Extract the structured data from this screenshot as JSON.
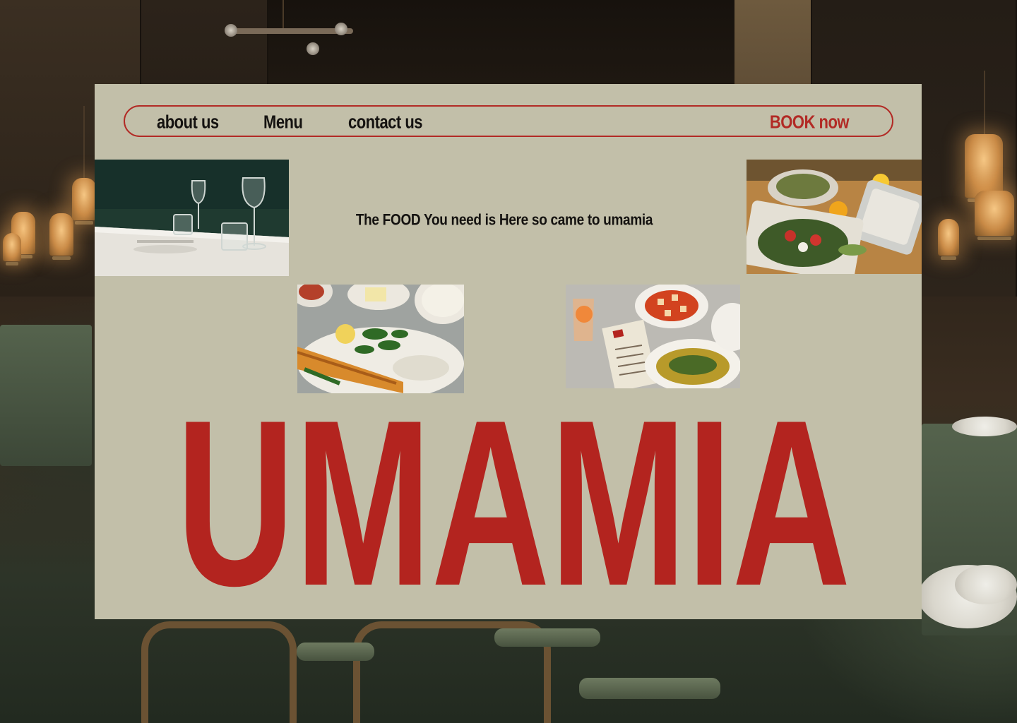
{
  "nav": {
    "about_label": "about us",
    "menu_label": "Menu",
    "contact_label": "contact us",
    "book_label": "BOOK now"
  },
  "hero": {
    "tagline": "The FOOD You need is Here so came to umamia",
    "brand": "UMAMIA"
  },
  "photos": [
    {
      "name": "wine-glasses-table-photo"
    },
    {
      "name": "salad-platter-photo"
    },
    {
      "name": "kebab-plate-photo"
    },
    {
      "name": "mezze-spread-photo"
    }
  ],
  "colors": {
    "card_bg": "#c2bfa9",
    "accent_red": "#b3241f",
    "text_dark": "#141210"
  }
}
